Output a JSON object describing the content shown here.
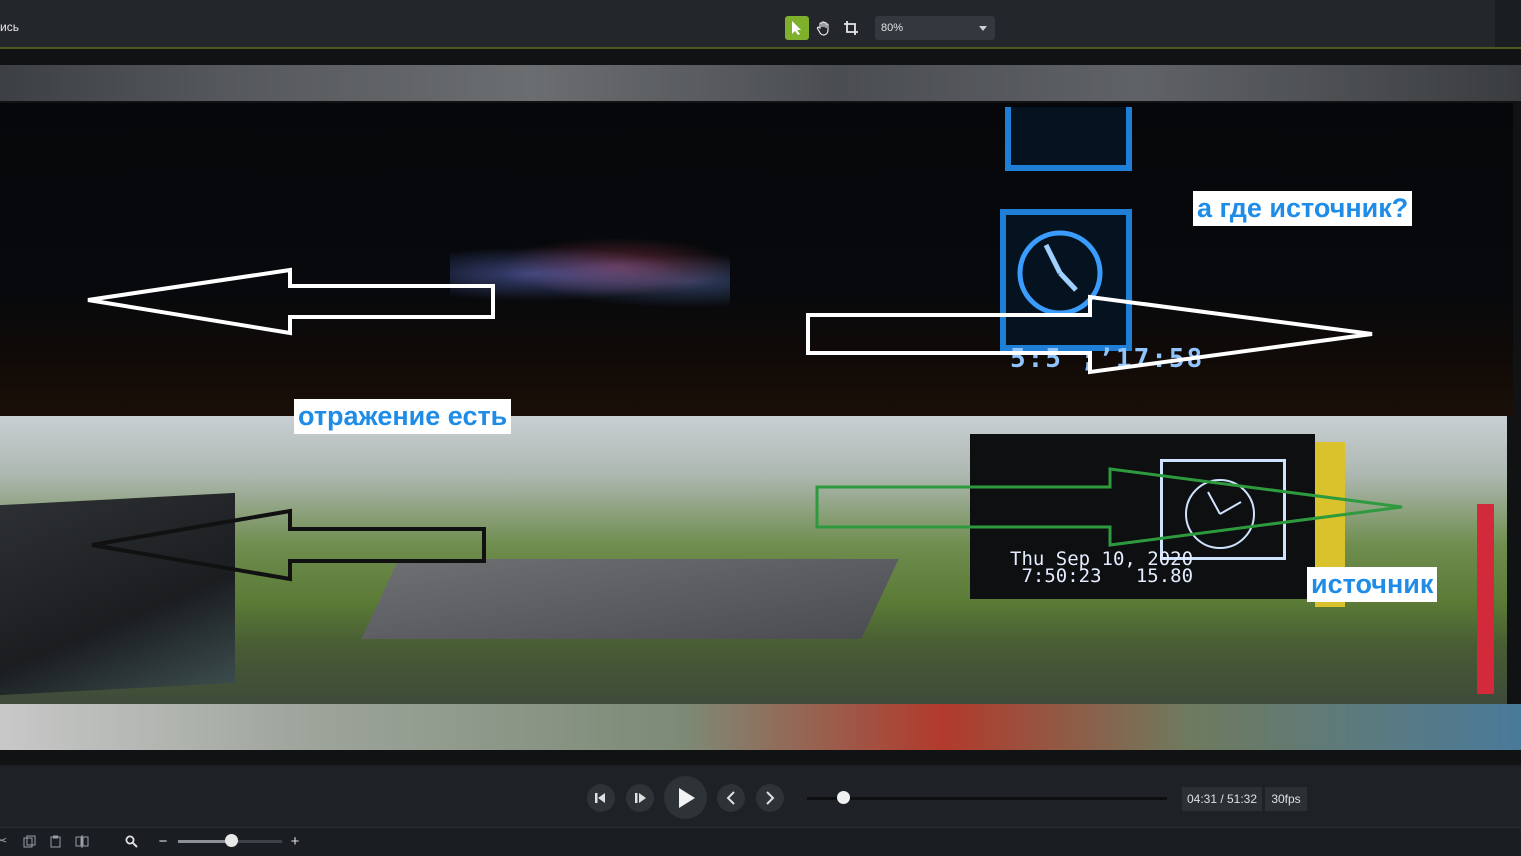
{
  "toolbar": {
    "project_label": "ись",
    "zoom_value": "80%",
    "tools": [
      "select-tool",
      "pan-tool",
      "crop-tool"
    ]
  },
  "canvas": {
    "labels": {
      "where_source": "а где источник?",
      "reflection_exists": "отражение есть",
      "source": "источник"
    },
    "clock_night_text": "5:5 ;’17:58",
    "device_text": "Thu Sep 10, 2020\n 7:50:23   15.80"
  },
  "transport": {
    "time": "04:31 / 51:32",
    "fps": "30fps",
    "progress_fraction": 0.08
  },
  "bottom": {
    "zoom_minus": "−",
    "zoom_plus": "+",
    "zoom_level_fraction": 0.5
  },
  "colors": {
    "accent": "#7fb02b",
    "label_text": "#1f8de8",
    "arrow_white": "#ffffff",
    "arrow_black": "#111111",
    "arrow_green": "#2e9a3e"
  }
}
